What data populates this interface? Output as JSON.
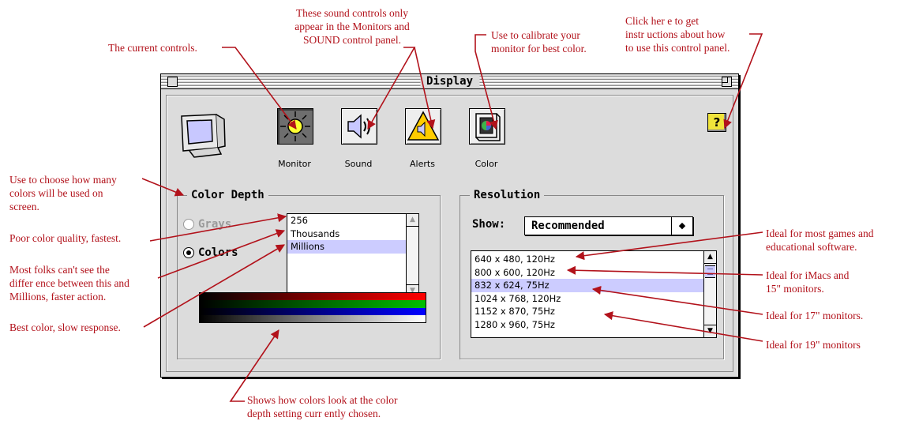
{
  "window": {
    "title": "Display"
  },
  "toolbar": [
    {
      "label": "Monitor",
      "icon": "sun-icon",
      "selected": true
    },
    {
      "label": "Sound",
      "icon": "speaker-icon",
      "selected": false
    },
    {
      "label": "Alerts",
      "icon": "alert-triangle-icon",
      "selected": false
    },
    {
      "label": "Color",
      "icon": "color-calibrate-icon",
      "selected": false
    }
  ],
  "help_button": {
    "label": "?"
  },
  "color_depth": {
    "title": "Color Depth",
    "grays_label": "Grays",
    "colors_label": "Colors",
    "selected_mode": "Colors",
    "options": [
      "256",
      "Thousands",
      "Millions"
    ],
    "selected_option": "Millions"
  },
  "resolution": {
    "title": "Resolution",
    "show_label": "Show:",
    "show_value": "Recommended",
    "items": [
      "640 x 480, 120Hz",
      "800 x 600, 120Hz",
      "832 x 624, 75Hz",
      "1024 x 768, 120Hz",
      "1152 x 870, 75Hz",
      "1280 x 960, 75Hz"
    ],
    "selected_item": "832 x 624, 75Hz"
  },
  "annotations": {
    "current_controls": "The current controls.",
    "sound_controls": [
      "These sound controls only",
      "appear in the Monitors and",
      "SOUND control panel."
    ],
    "calibrate": [
      "Use to calibrate your",
      "monitor for best color."
    ],
    "help": [
      "Click her e to get",
      "instr uctions about how",
      "to use this control panel."
    ],
    "choose_colors": [
      "Use to choose how many",
      "colors will be used on",
      "screen."
    ],
    "poor_quality": "Poor color quality, fastest.",
    "most_folks": [
      "Most folks can't see the",
      "differ ence between this and",
      "Millions, faster action."
    ],
    "best_color": "Best color, slow response.",
    "shows_colors": [
      "Shows how colors look at the color",
      "depth setting curr ently chosen."
    ],
    "ideal_games": [
      "Ideal for most games and",
      "educational software."
    ],
    "ideal_imacs": [
      "Ideal for iMacs and",
      "15\" monitors."
    ],
    "ideal_17": "Ideal for 17\" monitors.",
    "ideal_19": "Ideal for 19\" monitors"
  },
  "colors": {
    "annotation": "#b2121b",
    "selection": "#ccccff",
    "window_bg": "#dcdcdc"
  }
}
